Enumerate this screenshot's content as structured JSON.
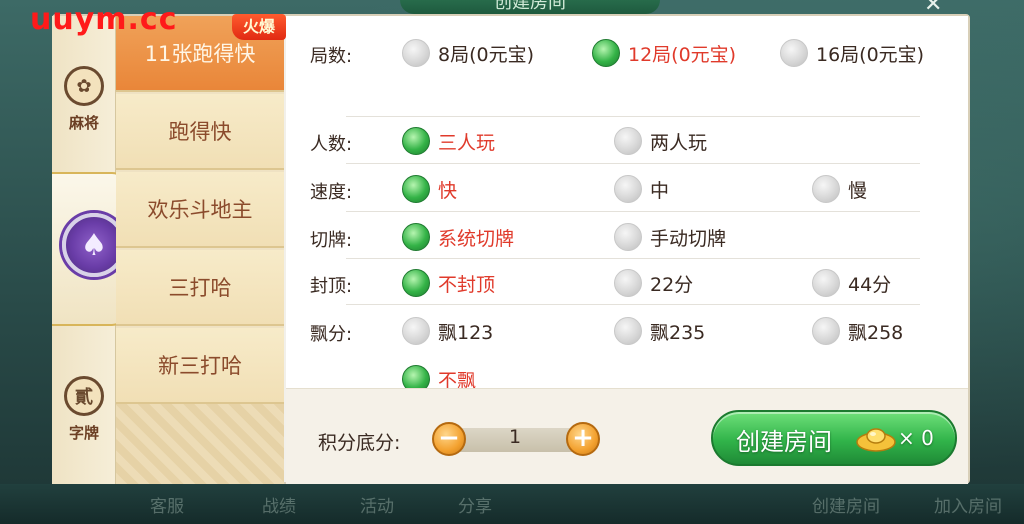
{
  "watermark": "uuym.cc",
  "dialog": {
    "title": "创建房间"
  },
  "categories": [
    {
      "id": "mahjong",
      "label": "麻将",
      "icon": "mahjong-icon",
      "glyph": "✿"
    },
    {
      "id": "poker",
      "label": "",
      "icon": "spade-chip-icon",
      "glyph": "♠"
    },
    {
      "id": "zipai",
      "label": "字牌",
      "icon": "er-character-icon",
      "glyph": "貳"
    }
  ],
  "games": [
    {
      "label": "11张跑得快",
      "badge": "火爆",
      "active": true
    },
    {
      "label": "跑得快",
      "active": false
    },
    {
      "label": "欢乐斗地主",
      "active": false
    },
    {
      "label": "三打哈",
      "active": false
    },
    {
      "label": "新三打哈",
      "active": false
    }
  ],
  "options": {
    "rounds": {
      "label": "局数:",
      "choices": [
        "8局(0元宝)",
        "12局(0元宝)",
        "16局(0元宝)"
      ],
      "selected": 1
    },
    "players": {
      "label": "人数:",
      "choices": [
        "三人玩",
        "两人玩"
      ],
      "selected": 0
    },
    "speed": {
      "label": "速度:",
      "choices": [
        "快",
        "中",
        "慢"
      ],
      "selected": 0
    },
    "cut": {
      "label": "切牌:",
      "choices": [
        "系统切牌",
        "手动切牌"
      ],
      "selected": 0
    },
    "cap": {
      "label": "封顶:",
      "choices": [
        "不封顶",
        "22分",
        "44分"
      ],
      "selected": 0
    },
    "float": {
      "label": "飘分:",
      "choices": [
        "飘123",
        "飘235",
        "飘258",
        "不飘"
      ],
      "selected": 3
    }
  },
  "bottom": {
    "score_label": "积分底分:",
    "score_value": "1",
    "minus": "−",
    "plus": "+",
    "create_label": "创建房间",
    "cost": "× 0"
  },
  "background_bar": [
    "客服",
    "战绩",
    "活动",
    "分享",
    "创建房间",
    "加入房间"
  ],
  "colors": {
    "accent_green": "#31b44a",
    "selected_text": "#e03a2b",
    "active_tab": "#e98639"
  }
}
